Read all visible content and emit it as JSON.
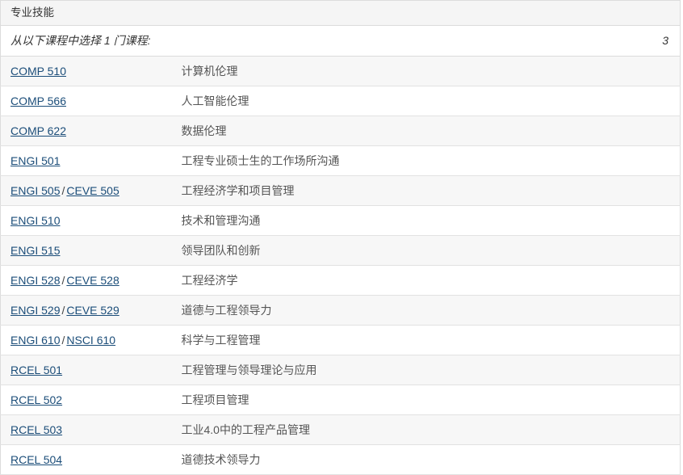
{
  "table": {
    "area_header": "专业技能",
    "comment": {
      "text": "从以下课程中选择 1 门课程:",
      "hours": "3"
    },
    "link_color": "#1b4d79",
    "title_color": "#555555",
    "header_bg": "#f5f5f5",
    "stripe_bg": "#f7f7f7",
    "border_color": "#dcdcdc",
    "rows": [
      {
        "codes": [
          "COMP 510"
        ],
        "title": "计算机伦理",
        "hours": ""
      },
      {
        "codes": [
          "COMP 566"
        ],
        "title": "人工智能伦理",
        "hours": ""
      },
      {
        "codes": [
          "COMP 622"
        ],
        "title": "数据伦理",
        "hours": ""
      },
      {
        "codes": [
          "ENGI 501"
        ],
        "title": "工程专业硕士生的工作场所沟通",
        "hours": ""
      },
      {
        "codes": [
          "ENGI 505",
          "CEVE 505"
        ],
        "title": "工程经济学和项目管理",
        "hours": ""
      },
      {
        "codes": [
          "ENGI 510"
        ],
        "title": "技术和管理沟通",
        "hours": ""
      },
      {
        "codes": [
          "ENGI 515"
        ],
        "title": "领导团队和创新",
        "hours": ""
      },
      {
        "codes": [
          "ENGI 528",
          "CEVE 528"
        ],
        "title": "工程经济学",
        "hours": ""
      },
      {
        "codes": [
          "ENGI 529",
          "CEVE 529"
        ],
        "title": "道德与工程领导力",
        "hours": ""
      },
      {
        "codes": [
          "ENGI 610",
          "NSCI 610"
        ],
        "title": "科学与工程管理",
        "hours": ""
      },
      {
        "codes": [
          "RCEL 501"
        ],
        "title": "工程管理与领导理论与应用",
        "hours": ""
      },
      {
        "codes": [
          "RCEL 502"
        ],
        "title": "工程项目管理",
        "hours": ""
      },
      {
        "codes": [
          "RCEL 503"
        ],
        "title": "工业4.0中的工程产品管理",
        "hours": ""
      },
      {
        "codes": [
          "RCEL 504"
        ],
        "title": "道德技术领导力",
        "hours": ""
      }
    ],
    "code_separator": "/"
  }
}
